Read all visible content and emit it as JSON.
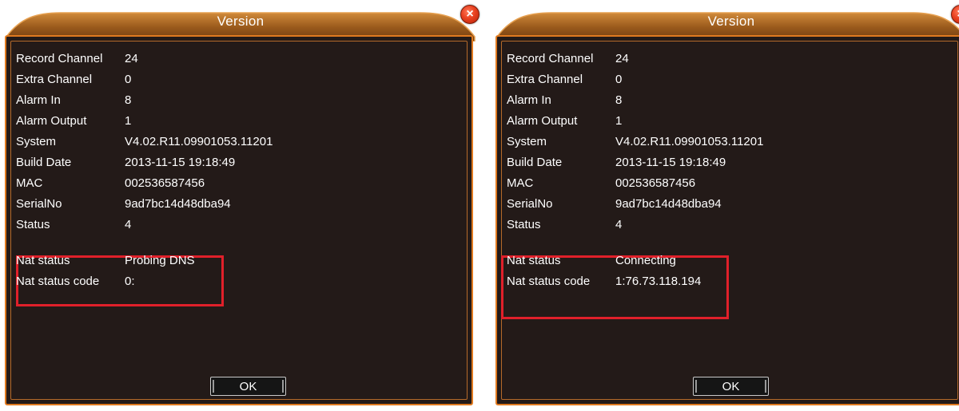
{
  "dialogs": [
    {
      "title": "Version",
      "rows": [
        {
          "label": "Record Channel",
          "value": "24"
        },
        {
          "label": "Extra Channel",
          "value": "0"
        },
        {
          "label": "Alarm In",
          "value": "8"
        },
        {
          "label": "Alarm Output",
          "value": "1"
        },
        {
          "label": "System",
          "value": "V4.02.R11.09901053.11201"
        },
        {
          "label": "Build Date",
          "value": "2013-11-15 19:18:49"
        },
        {
          "label": "MAC",
          "value": "002536587456"
        },
        {
          "label": "SerialNo",
          "value": "9ad7bc14d48dba94"
        },
        {
          "label": "Status",
          "value": "4"
        }
      ],
      "nat_status_label": "Nat status",
      "nat_status_value": "Probing DNS",
      "nat_code_label": "Nat status code",
      "nat_code_value": "0:",
      "ok_label": "OK",
      "close_icon": "close-icon"
    },
    {
      "title": "Version",
      "rows": [
        {
          "label": "Record Channel",
          "value": "24"
        },
        {
          "label": "Extra Channel",
          "value": "0"
        },
        {
          "label": "Alarm In",
          "value": "8"
        },
        {
          "label": "Alarm Output",
          "value": "1"
        },
        {
          "label": "System",
          "value": "V4.02.R11.09901053.11201"
        },
        {
          "label": "Build Date",
          "value": "2013-11-15 19:18:49"
        },
        {
          "label": "MAC",
          "value": "002536587456"
        },
        {
          "label": "SerialNo",
          "value": "9ad7bc14d48dba94"
        },
        {
          "label": "Status",
          "value": "4"
        }
      ],
      "nat_status_label": "Nat status",
      "nat_status_value": "Connecting",
      "nat_code_label": "Nat status code",
      "nat_code_value": "1:76.73.118.194",
      "ok_label": "OK",
      "close_icon": "close-icon"
    }
  ],
  "colors": {
    "panel_background": "#231a18",
    "border_accent": "#e07a20",
    "highlight": "#e0202a",
    "text": "#ffffff"
  }
}
